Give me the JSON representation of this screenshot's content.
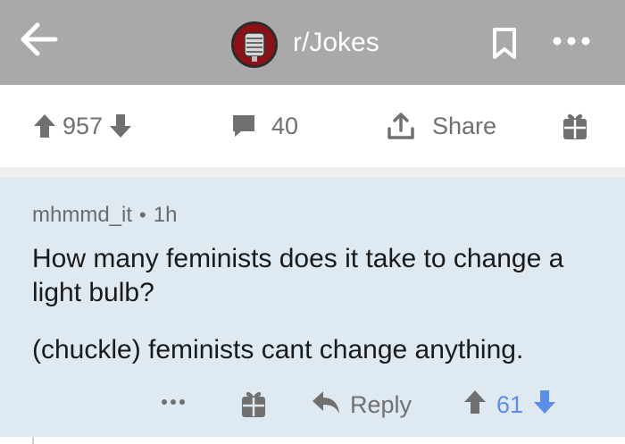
{
  "header": {
    "subreddit": "r/Jokes",
    "colors": {
      "bar": "#a9a9a9",
      "icon": "#ffffff"
    }
  },
  "post_actions": {
    "score": "957",
    "comments": "40",
    "share_label": "Share",
    "icon_color": "#707070"
  },
  "comment": {
    "author": "mhmmd_it",
    "separator": "•",
    "age": "1h",
    "body": [
      "How many feminists does it take to change a light bulb?",
      "(chuckle) feminists cant change anything."
    ],
    "reply_label": "Reply",
    "score": "61",
    "colors": {
      "background": "#dfe9f1",
      "score": "#5b8ee6"
    }
  }
}
